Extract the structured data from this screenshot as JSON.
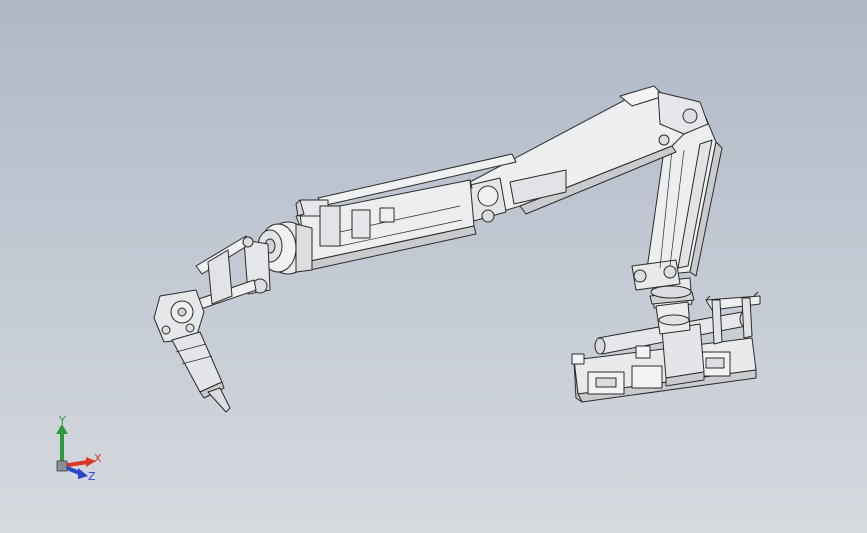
{
  "view": {
    "background_top": "#aeb8c7",
    "background_bottom": "#d6dadf",
    "part_fill": "#ecedef",
    "part_edge": "#2b2b2b",
    "part_shade": "#c9cbcf"
  },
  "triad": {
    "x_label": "X",
    "y_label": "Y",
    "z_label": "Z",
    "x_color": "#d83a2a",
    "y_color": "#2c9a3a",
    "z_color": "#2846c8"
  }
}
